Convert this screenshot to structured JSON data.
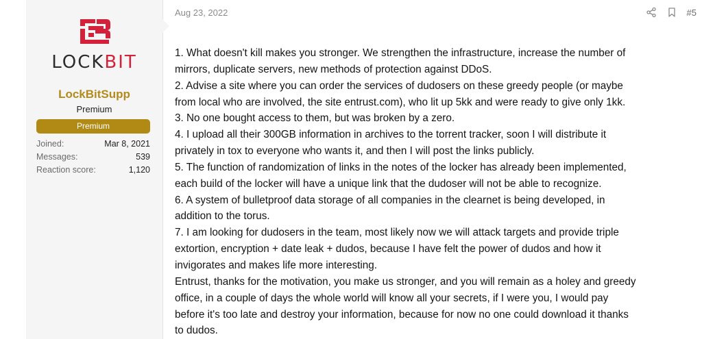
{
  "user": {
    "logo_text_dark": "LOCK",
    "logo_text_red": "BIT",
    "username": "LockBitSupp",
    "user_title": "Premium",
    "banner": "Premium",
    "stats": [
      {
        "label": "Joined:",
        "value": "Mar 8, 2021"
      },
      {
        "label": "Messages:",
        "value": "539"
      },
      {
        "label": "Reaction score:",
        "value": "1,120"
      }
    ]
  },
  "post": {
    "date": "Aug 23, 2022",
    "number": "#5",
    "icons": {
      "share": "share-icon",
      "bookmark": "bookmark-icon"
    },
    "lines": [
      "1. What doesn't kill makes you stronger. We strengthen the infrastructure, increase the number of",
      "mirrors, duplicate servers, new methods of protection against DDoS.",
      "2. Advise a site where you can order the services of dudosers on these greedy people (or maybe",
      "from local who are involved, the site entrust.com), who lit up 5kk and were ready to give only 1kk.",
      "3. No one bought access to them, but was broken by a zero.",
      "4. I upload all their 300GB information in archives to the torrent tracker, soon I will distribute it",
      "privately in tox to everyone who wants it, and then I will post the links publicly.",
      "5. The function of randomization of links in the notes of the locker has already been implemented,",
      "each build of the locker will have a unique link that the dudoser will not be able to recognize.",
      "6. A system of bulletproof data storage of all companies in the clearnet is being developed, in",
      "addition to the torus.",
      "7. I am looking for dudosers in the team, most likely now we will attack targets and provide triple",
      "extortion, encryption + date leak + dudos, because I have felt the power of dudos and how it",
      "invigorates and makes life more interesting.",
      "Entrust, thanks for the motivation, you make us stronger, and you will remain as a holey and greedy",
      "office, in a couple of days the whole world will know all your secrets, if I were you, I would pay",
      "before it's too late and destroy your information, because for now no one could download it thanks",
      "to dudos."
    ]
  },
  "colors": {
    "username": "#b48a1c",
    "banner_bg": "#b08a14",
    "logo_red": "#d3213b",
    "sidebar_bg": "#f5f5f5"
  }
}
